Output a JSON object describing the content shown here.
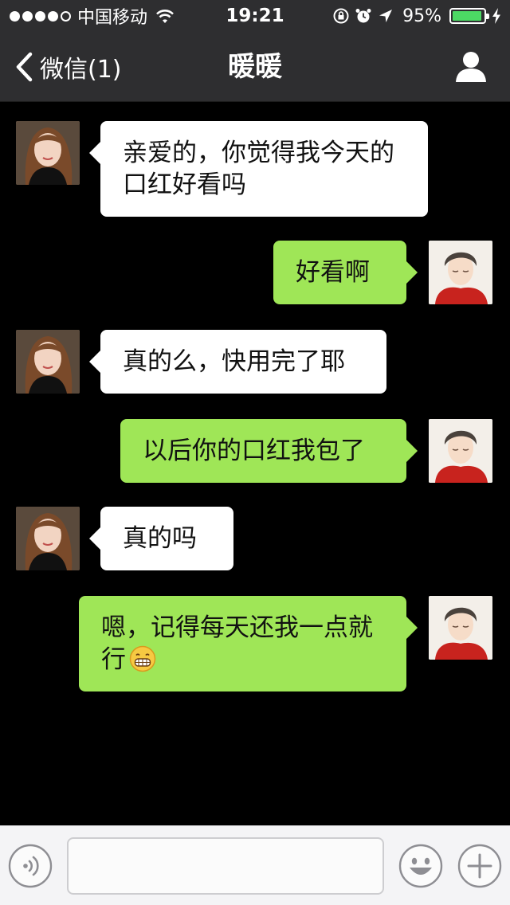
{
  "status_bar": {
    "carrier": "中国移动",
    "time": "19:21",
    "battery_percent": "95%",
    "battery_level": 0.95,
    "signal_bars_filled": 4,
    "signal_bars_total": 5,
    "battery_color": "#4cd964"
  },
  "nav": {
    "back_label": "微信(1)",
    "title": "暖暖",
    "profile_icon": "person-icon"
  },
  "messages": [
    {
      "sender": "contact",
      "text": "亲爱的，你觉得我今天的口红好看吗"
    },
    {
      "sender": "me",
      "text": "好看啊"
    },
    {
      "sender": "contact",
      "text": "真的么，快用完了耶"
    },
    {
      "sender": "me",
      "text": "以后你的口红我包了"
    },
    {
      "sender": "contact",
      "text": "真的吗"
    },
    {
      "sender": "me",
      "text": "嗯，记得每天还我一点就行",
      "emoji": "grin-emoji"
    }
  ],
  "input": {
    "value": "",
    "voice_icon": "voice-icon",
    "emoji_icon": "smiley-icon",
    "plus_icon": "plus-icon"
  },
  "colors": {
    "outgoing_bubble": "#9fe657",
    "incoming_bubble": "#ffffff",
    "chat_background": "#000000",
    "bar_background": "#2e2e30"
  }
}
